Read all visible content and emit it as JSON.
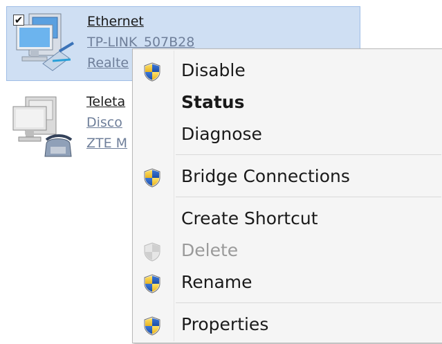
{
  "connections": [
    {
      "checked": true,
      "name": "Ethernet",
      "line2": "TP-LINK_507B28",
      "line3": "Realte"
    },
    {
      "name": "Teleta",
      "line2": "Disco",
      "line3": "ZTE M"
    }
  ],
  "menu": {
    "items": [
      {
        "label": "Disable",
        "icon": "shield-icon"
      },
      {
        "label": "Status",
        "bold": true
      },
      {
        "label": "Diagnose"
      },
      {
        "label": "Bridge Connections",
        "icon": "shield-icon"
      },
      {
        "label": "Create Shortcut"
      },
      {
        "label": "Delete",
        "icon": "shield-icon",
        "disabled": true
      },
      {
        "label": "Rename",
        "icon": "shield-icon"
      },
      {
        "label": "Properties",
        "icon": "shield-icon"
      }
    ]
  },
  "colors": {
    "selection": "#cfdff3",
    "selection_border": "#9fbde6",
    "menu_bg": "#f5f5f5",
    "link_gray": "#6f7f9a"
  },
  "checkmark": "✔"
}
